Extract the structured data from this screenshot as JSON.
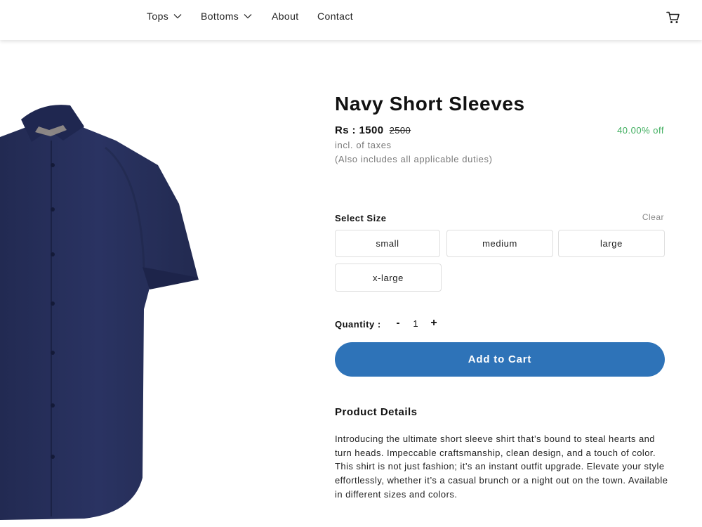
{
  "nav": {
    "items": [
      {
        "label": "Tops",
        "has_dropdown": true
      },
      {
        "label": "Bottoms",
        "has_dropdown": true
      },
      {
        "label": "About",
        "has_dropdown": false
      },
      {
        "label": "Contact",
        "has_dropdown": false
      }
    ],
    "cart_icon": "cart-icon"
  },
  "product": {
    "title": "Navy Short Sleeves",
    "price_current": "Rs : 1500",
    "price_old": "2500",
    "discount": "40.00% off",
    "tax_note": "incl. of taxes",
    "duties_note": "(Also includes all applicable duties)",
    "image_color": "#27305a"
  },
  "size": {
    "label": "Select Size",
    "clear": "Clear",
    "options": [
      "small",
      "medium",
      "large",
      "x-large"
    ]
  },
  "quantity": {
    "label": "Quantity :",
    "minus": "-",
    "value": "1",
    "plus": "+"
  },
  "cta": {
    "add_to_cart": "Add to Cart",
    "color": "#2e73b8"
  },
  "details": {
    "title": "Product Details",
    "text": "Introducing the ultimate short sleeve shirt that’s bound to steal hearts and turn heads. Impeccable craftsmanship, clean design, and a touch of color. This shirt is not just fashion; it’s an instant outfit upgrade. Elevate your style effortlessly, whether it’s a casual brunch or a night out on the town. Available in different sizes and colors."
  },
  "colors": {
    "discount": "#3fae5e",
    "muted": "#7a7a7a"
  }
}
